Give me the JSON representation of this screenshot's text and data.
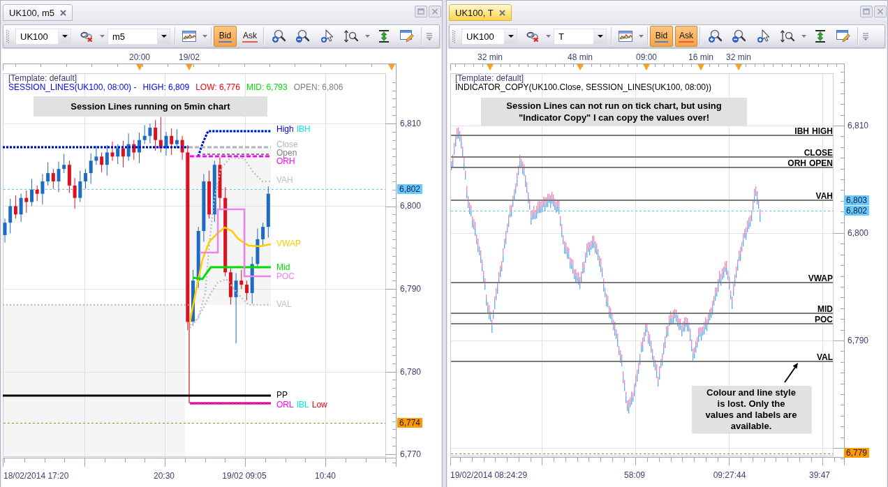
{
  "panels": [
    {
      "tab": {
        "label": "UK100, m5",
        "selected": false
      },
      "toolbar": {
        "symbol": "UK100",
        "timeframe": "m5",
        "price_buttons": [
          {
            "label": "Bid",
            "selected": true
          },
          {
            "label": "Ask",
            "selected": false
          }
        ]
      },
      "chart": {
        "kind": "candles",
        "time_axis_top": [
          "20:00",
          "19/02"
        ],
        "template": "[Template: default]",
        "legend": [
          {
            "text": "SESSION_LINES(UK100, 08:00) -",
            "color": "#0000ff"
          },
          {
            "text": "HIGH: 6,809",
            "color": "#0000ff"
          },
          {
            "text": "LOW: 6,776",
            "color": "#ff0000"
          },
          {
            "text": "MID: 6,793",
            "color": "#00dd00"
          },
          {
            "text": "OPEN: 6,806",
            "color": "#808080"
          }
        ],
        "note": "Session Lines running on 5min chart",
        "session_lines": [
          {
            "labels": [
              {
                "text": "High",
                "color": "#0000dd"
              },
              {
                "text": "IBH",
                "color": "#00e5ee"
              }
            ]
          },
          {
            "labels": [
              {
                "text": "Close",
                "color": "#b4b4b4"
              }
            ]
          },
          {
            "labels": [
              {
                "text": "Open",
                "color": "#808080"
              }
            ]
          },
          {
            "labels": [
              {
                "text": "ORH",
                "color": "#ff00ff"
              }
            ]
          },
          {
            "labels": [
              {
                "text": "VAH",
                "color": "#c0c0c0"
              }
            ]
          },
          {
            "labels": [
              {
                "text": "VWAP",
                "color": "#ffcc00"
              }
            ]
          },
          {
            "labels": [
              {
                "text": "Mid",
                "color": "#00dd00"
              }
            ]
          },
          {
            "labels": [
              {
                "text": "POC",
                "color": "#ee82ee"
              }
            ]
          },
          {
            "labels": [
              {
                "text": "VAL",
                "color": "#c0c0c0"
              }
            ]
          },
          {
            "labels": [
              {
                "text": "PP",
                "color": "#000000"
              }
            ]
          },
          {
            "labels": [
              {
                "text": "ORL",
                "color": "#ff00ff"
              },
              {
                "text": "IBL",
                "color": "#00e5ee"
              },
              {
                "text": "Low",
                "color": "#ee0000"
              }
            ]
          }
        ],
        "price_axis": [
          "6,810",
          "6,800",
          "6,790",
          "6,780",
          "6,770"
        ],
        "price_tags": [
          {
            "text": "6,802",
            "color": "#66ccff"
          },
          {
            "text": "6,774",
            "color": "#ff9900"
          }
        ],
        "time_axis_bottom": [
          "18/02/2014 17:20",
          "20:30",
          "19/02 09:05",
          "10:40"
        ]
      }
    },
    {
      "tab": {
        "label": "UK100, T",
        "selected": true
      },
      "toolbar": {
        "symbol": "UK100",
        "timeframe": "T",
        "price_buttons": [
          {
            "label": "Bid",
            "selected": true
          },
          {
            "label": "Ask",
            "selected": true
          }
        ]
      },
      "chart": {
        "kind": "ticks",
        "time_axis_top": [
          "32 min",
          "48 min",
          "09:00",
          "16 min",
          "32 min"
        ],
        "template": "[Template: default]",
        "indicator": "INDICATOR_COPY(UK100.Close, SESSION_LINES(UK100, 08:00))",
        "note": "Session Lines can not run on tick chart, but using\n\"Indicator Copy\" I can copy the values over!",
        "session_lines": [
          {
            "labels": [
              "IBH",
              "HIGH"
            ]
          },
          {
            "labels": [
              "CLOSE"
            ]
          },
          {
            "labels": [
              "ORH",
              "OPEN"
            ]
          },
          {
            "labels": [
              "VAH"
            ]
          },
          {
            "labels": [
              "VWAP"
            ]
          },
          {
            "labels": [
              "MID"
            ]
          },
          {
            "labels": [
              "POC"
            ]
          },
          {
            "labels": [
              "VAL"
            ]
          }
        ],
        "callout": "Colour and line style\nis lost. Only the\nvalues and labels are\navailable.",
        "price_axis": [
          "6,810",
          "6,800",
          "6,790"
        ],
        "price_tags": [
          {
            "text": "6,803",
            "color": "#66ccff"
          },
          {
            "text": "6,802",
            "color": "#66ccff"
          },
          {
            "text": "6,779",
            "color": "#ff9900"
          }
        ],
        "time_axis_bottom": [
          "19/02/2014 08:24:29",
          "58:09",
          "09:27:44",
          "39:47"
        ]
      }
    }
  ]
}
